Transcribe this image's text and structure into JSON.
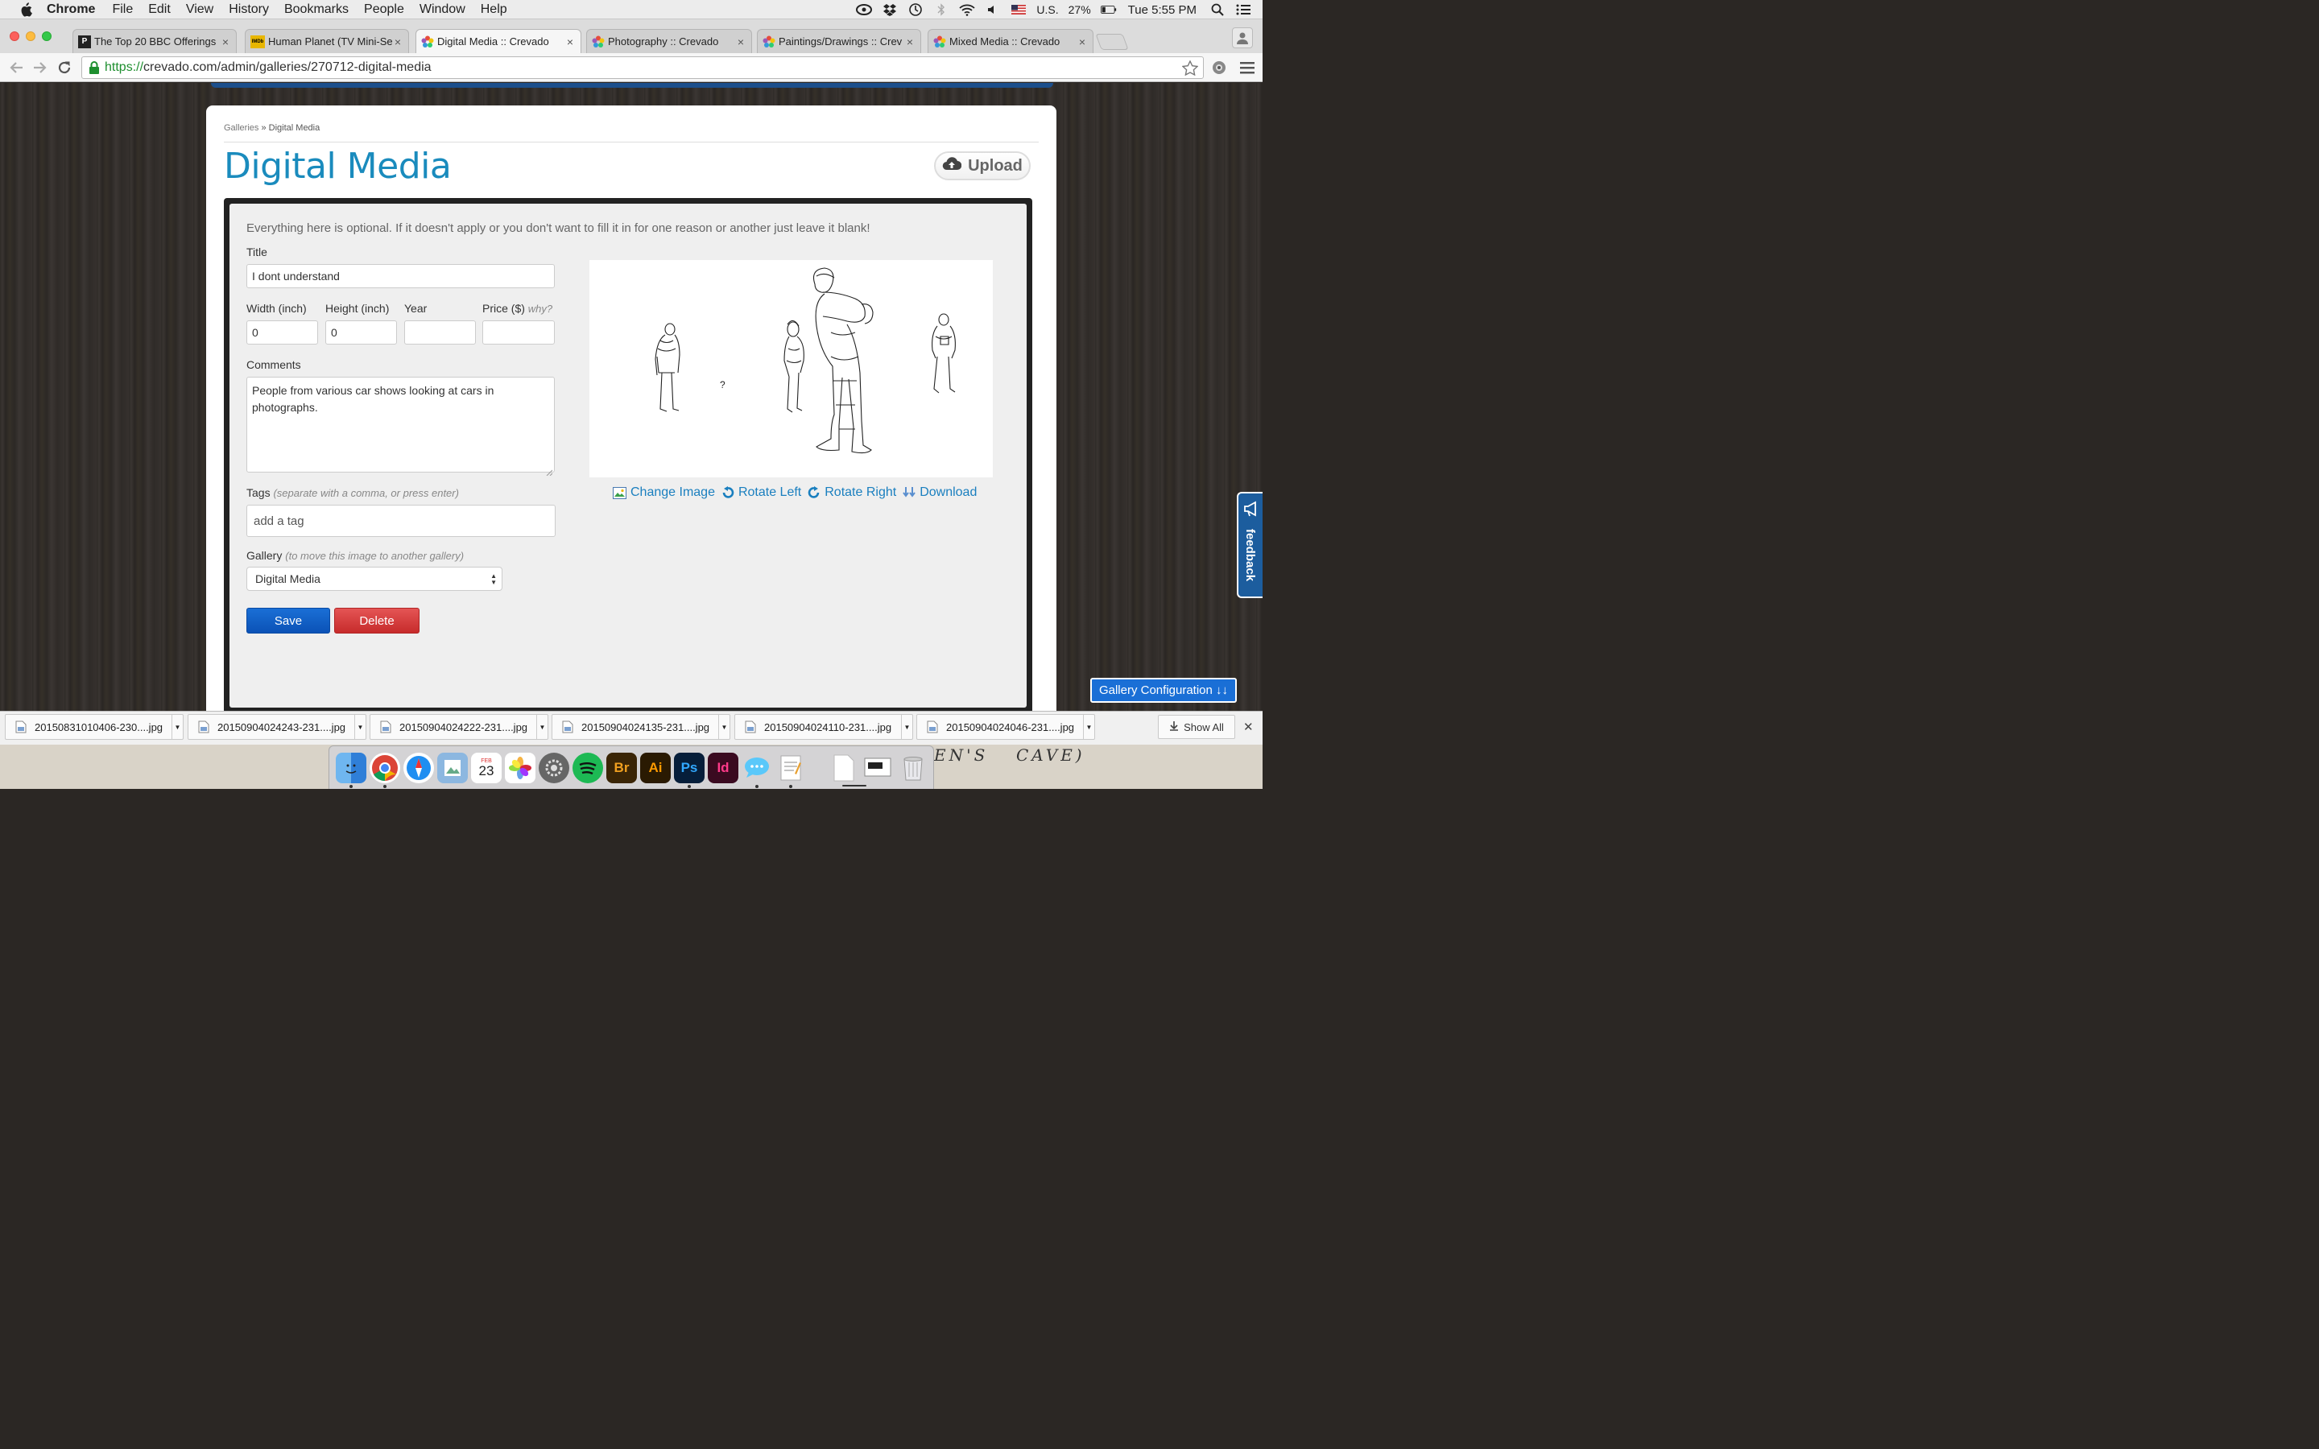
{
  "menubar": {
    "app": "Chrome",
    "items": [
      "File",
      "Edit",
      "View",
      "History",
      "Bookmarks",
      "People",
      "Window",
      "Help"
    ],
    "input_source": "U.S.",
    "battery": "27%",
    "clock": "Tue 5:55 PM"
  },
  "tabs": [
    {
      "label": "The Top 20 BBC Offerings",
      "favicon": "P"
    },
    {
      "label": "Human Planet (TV Mini-Ser",
      "favicon": "IMDb"
    },
    {
      "label": "Digital Media :: Crevado",
      "favicon": "crevado"
    },
    {
      "label": "Photography :: Crevado",
      "favicon": "crevado"
    },
    {
      "label": "Paintings/Drawings :: Crev",
      "favicon": "crevado"
    },
    {
      "label": "Mixed Media :: Crevado",
      "favicon": "crevado"
    }
  ],
  "address": {
    "https": "https://",
    "rest": "crevado.com/admin/galleries/270712-digital-media"
  },
  "breadcrumb": {
    "root": "Galleries",
    "sep": "»",
    "current": "Digital Media"
  },
  "page": {
    "title": "Digital Media",
    "upload_label": "Upload"
  },
  "form": {
    "intro": "Everything here is optional. If it doesn't apply or you don't want to fill it in for one reason or another just leave it blank!",
    "title_label": "Title",
    "title_value": "I dont understand",
    "width_label": "Width (inch)",
    "width_value": "0",
    "height_label": "Height (inch)",
    "height_value": "0",
    "year_label": "Year",
    "year_value": "",
    "price_label": "Price ($)",
    "price_hint": "why?",
    "price_value": "",
    "comments_label": "Comments",
    "comments_value": "People from various car shows looking at cars in photographs.",
    "tags_label": "Tags",
    "tags_hint": "(separate with a comma, or press enter)",
    "tags_placeholder": "add a tag",
    "gallery_label": "Gallery",
    "gallery_hint": "(to move this image to another gallery)",
    "gallery_value": "Digital Media",
    "save_label": "Save",
    "delete_label": "Delete"
  },
  "image": {
    "question_mark": "?",
    "actions": {
      "change": "Change Image",
      "rotate_left": "Rotate Left",
      "rotate_right": "Rotate Right",
      "download": "Download"
    }
  },
  "feedback_label": "feedback",
  "gallery_config_label": "Gallery Configuration ↓↓",
  "downloads": [
    "20150831010406-230....jpg",
    "20150904024243-231....jpg",
    "20150904024222-231....jpg",
    "20150904024135-231....jpg",
    "20150904024110-231....jpg",
    "20150904024046-231....jpg"
  ],
  "show_all_label": "Show All",
  "desk_text": {
    "left": "EN'S",
    "right": "CAVE)"
  },
  "dock": {
    "calendar_month": "FEB",
    "calendar_day": "23",
    "apps": [
      "finder-icon",
      "chrome-icon",
      "safari-icon",
      "preview-icon",
      "calendar-icon",
      "photos-icon",
      "system-preferences-icon",
      "spotify-icon",
      "bridge-icon",
      "illustrator-icon",
      "photoshop-icon",
      "indesign-icon",
      "messages-icon",
      "textedit-icon",
      "document-icon",
      "screen-icon",
      "trash-icon"
    ],
    "labels": {
      "bridge": "Br",
      "illustrator": "Ai",
      "photoshop": "Ps",
      "indesign": "Id"
    }
  },
  "colors": {
    "title_blue": "#1a8bbd",
    "link_blue": "#1a7fbf",
    "save_blue": "#1a6fd6",
    "delete_red": "#d63c3c",
    "url_green": "#1e8f2f"
  }
}
